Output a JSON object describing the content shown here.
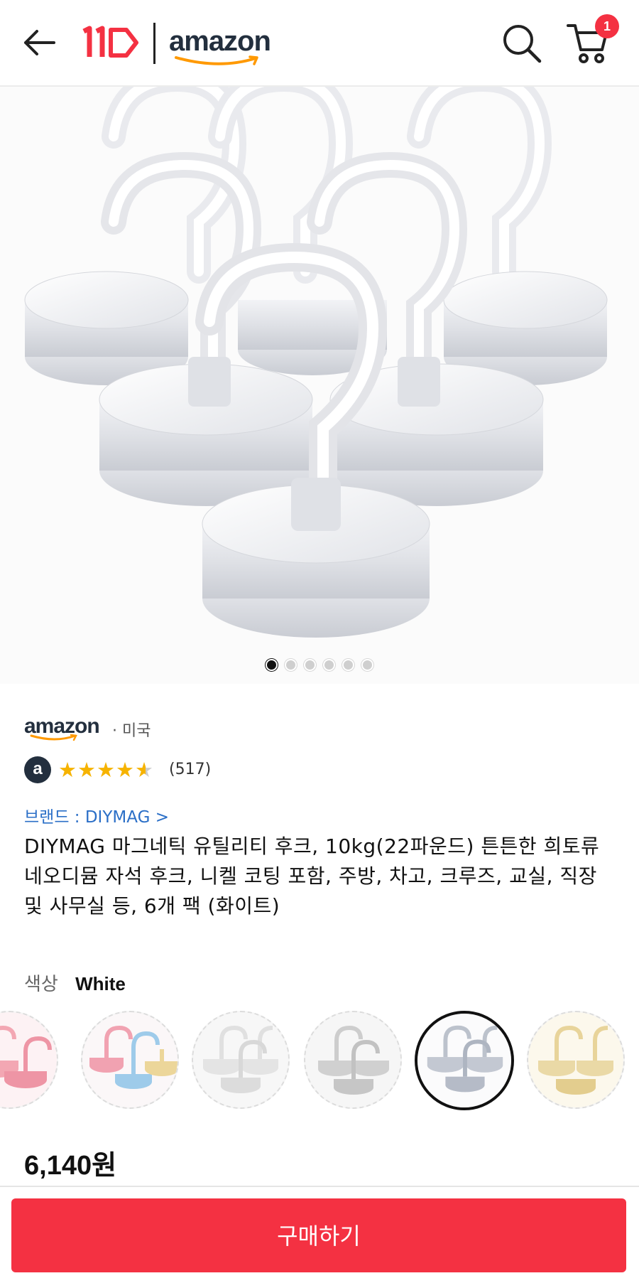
{
  "header": {
    "logo_11st": "11",
    "amazon_logo_text": "amazon",
    "cart_count": "1"
  },
  "carousel": {
    "image_count": 6,
    "active_index": 0
  },
  "seller": {
    "store_name": "amazon",
    "country": "· 미국",
    "badge_letter": "a",
    "rating": 4.5,
    "review_count": "(517)"
  },
  "product": {
    "brand_link": "브랜드 : DIYMAG >",
    "title": "DIYMAG 마그네틱 유틸리티 후크, 10kg(22파운드) 튼튼한 희토류 네오디뮴 자석 후크, 니켈 코팅 포함, 주방, 차고, 크루즈, 교실, 직장 및 사무실 등, 6개 팩 (화이트)",
    "color_label": "색상",
    "color_value": "White",
    "swatches": [
      {
        "name": "pink",
        "color": "#f3a7b3"
      },
      {
        "name": "pink-blue-yellow",
        "color": "#e8a6b4"
      },
      {
        "name": "clear",
        "color": "#e8e8e8"
      },
      {
        "name": "silver",
        "color": "#d6d6d6"
      },
      {
        "name": "white",
        "color": "#b9bfca",
        "selected": true
      },
      {
        "name": "gold",
        "color": "#ead9a6"
      }
    ],
    "price": "6,140원"
  },
  "actions": {
    "buy_label": "구매하기"
  },
  "colors": {
    "accent": "#f43142",
    "amazon_dark": "#232f3e",
    "amazon_orange": "#ff9900",
    "link_blue": "#2b6fc7",
    "star": "#f6b300"
  }
}
